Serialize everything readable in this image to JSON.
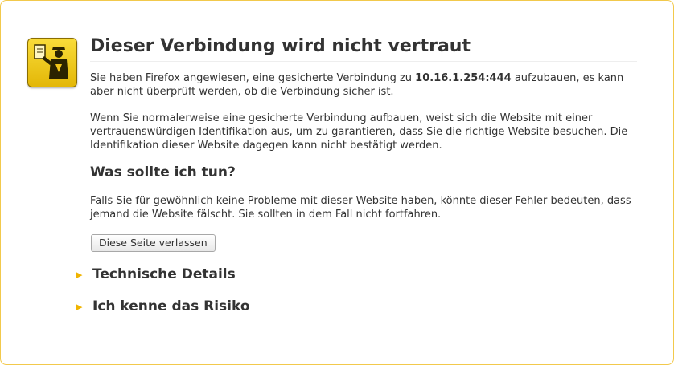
{
  "page": {
    "title": "Dieser Verbindung wird nicht vertraut",
    "intro_prefix": "Sie haben Firefox angewiesen, eine gesicherte Verbindung zu ",
    "host": "10.16.1.254:444",
    "intro_suffix": " aufzubauen, es kann aber nicht überprüft werden, ob die Verbindung sicher ist.",
    "explanation": "Wenn Sie normalerweise eine gesicherte Verbindung aufbauen, weist sich die Website mit einer vertrauenswürdigen Identifikation aus, um zu garantieren, dass Sie die richtige Website besuchen. Die Identifikation dieser Website dagegen kann nicht bestätigt werden.",
    "what_heading": "Was sollte ich tun?",
    "what_text": "Falls Sie für gewöhnlich keine Probleme mit dieser Website haben, könnte dieser Fehler bedeuten, dass jemand die Website fälscht. Sie sollten in dem Fall nicht fortfahren.",
    "leave_button": "Diese Seite verlassen",
    "expanders": [
      {
        "label": "Technische Details",
        "icon": "triangle-right-icon"
      },
      {
        "label": "Ich kenne das Risiko",
        "icon": "triangle-right-icon"
      }
    ]
  },
  "icon": {
    "name": "security-officer-icon",
    "color": "#f0c419"
  },
  "colors": {
    "accent": "#f0b400",
    "border": "#f2c94c",
    "text": "#333333"
  }
}
